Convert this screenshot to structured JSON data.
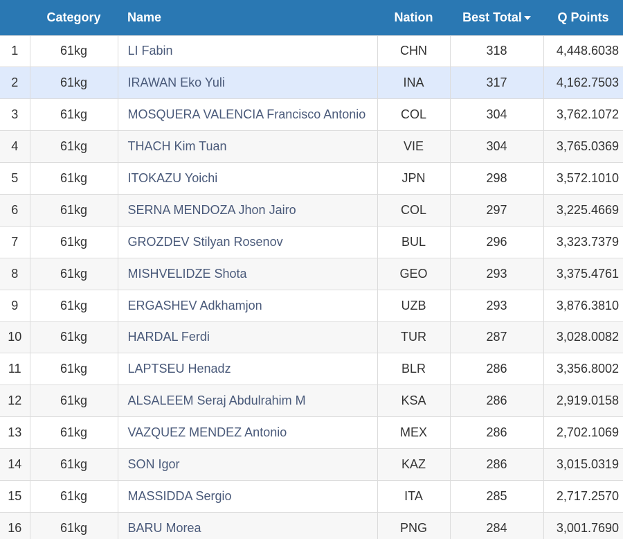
{
  "table": {
    "headers": {
      "rank": "",
      "category": "Category",
      "name": "Name",
      "nation": "Nation",
      "best_total": "Best Total",
      "q_points": "Q Points"
    },
    "sort": {
      "column": "best_total",
      "direction": "descending"
    },
    "selected_row": 2,
    "rows": [
      {
        "rank": "1",
        "category": "61kg",
        "name": "LI Fabin",
        "nation": "CHN",
        "best_total": "318",
        "q_points": "4,448.6038"
      },
      {
        "rank": "2",
        "category": "61kg",
        "name": "IRAWAN Eko Yuli",
        "nation": "INA",
        "best_total": "317",
        "q_points": "4,162.7503"
      },
      {
        "rank": "3",
        "category": "61kg",
        "name": "MOSQUERA VALENCIA Francisco Antonio",
        "nation": "COL",
        "best_total": "304",
        "q_points": "3,762.1072"
      },
      {
        "rank": "4",
        "category": "61kg",
        "name": "THACH Kim Tuan",
        "nation": "VIE",
        "best_total": "304",
        "q_points": "3,765.0369"
      },
      {
        "rank": "5",
        "category": "61kg",
        "name": "ITOKAZU Yoichi",
        "nation": "JPN",
        "best_total": "298",
        "q_points": "3,572.1010"
      },
      {
        "rank": "6",
        "category": "61kg",
        "name": "SERNA MENDOZA Jhon Jairo",
        "nation": "COL",
        "best_total": "297",
        "q_points": "3,225.4669"
      },
      {
        "rank": "7",
        "category": "61kg",
        "name": "GROZDEV Stilyan Rosenov",
        "nation": "BUL",
        "best_total": "296",
        "q_points": "3,323.7379"
      },
      {
        "rank": "8",
        "category": "61kg",
        "name": "MISHVELIDZE Shota",
        "nation": "GEO",
        "best_total": "293",
        "q_points": "3,375.4761"
      },
      {
        "rank": "9",
        "category": "61kg",
        "name": "ERGASHEV Adkhamjon",
        "nation": "UZB",
        "best_total": "293",
        "q_points": "3,876.3810"
      },
      {
        "rank": "10",
        "category": "61kg",
        "name": "HARDAL Ferdi",
        "nation": "TUR",
        "best_total": "287",
        "q_points": "3,028.0082"
      },
      {
        "rank": "11",
        "category": "61kg",
        "name": "LAPTSEU Henadz",
        "nation": "BLR",
        "best_total": "286",
        "q_points": "3,356.8002"
      },
      {
        "rank": "12",
        "category": "61kg",
        "name": "ALSALEEM Seraj Abdulrahim M",
        "nation": "KSA",
        "best_total": "286",
        "q_points": "2,919.0158"
      },
      {
        "rank": "13",
        "category": "61kg",
        "name": "VAZQUEZ MENDEZ Antonio",
        "nation": "MEX",
        "best_total": "286",
        "q_points": "2,702.1069"
      },
      {
        "rank": "14",
        "category": "61kg",
        "name": "SON Igor",
        "nation": "KAZ",
        "best_total": "286",
        "q_points": "3,015.0319"
      },
      {
        "rank": "15",
        "category": "61kg",
        "name": "MASSIDDA Sergio",
        "nation": "ITA",
        "best_total": "285",
        "q_points": "2,717.2570"
      },
      {
        "rank": "16",
        "category": "61kg",
        "name": "BARU Morea",
        "nation": "PNG",
        "best_total": "284",
        "q_points": "3,001.7690"
      }
    ]
  },
  "colors": {
    "header_bg": "#2a78b3",
    "header_text": "#ffffff",
    "selected_row_bg": "#dfeafc",
    "name_link": "#4a5a7a"
  }
}
